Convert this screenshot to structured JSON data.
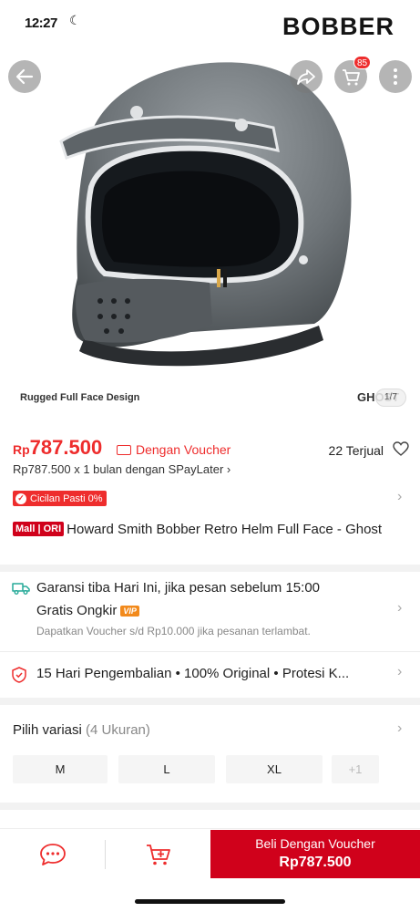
{
  "status_bar": {
    "time": "12:27",
    "moon_icon": "moon-icon"
  },
  "hero": {
    "brand_text": "BOBBER",
    "cart_count": "85",
    "caption": "Rugged Full Face Design",
    "model_text": "GHOST",
    "image_counter": "1/7",
    "icons": [
      "back-arrow-icon",
      "share-icon",
      "cart-icon",
      "more-icon"
    ]
  },
  "price": {
    "currency": "Rp",
    "amount": "787.500",
    "voucher_label": "Dengan Voucher",
    "sold": "22 Terjual",
    "spaylater": "Rp787.500 x 1 bulan dengan SPayLater",
    "cicilan": "Cicilan Pasti 0%"
  },
  "product": {
    "mall_badge": "Mall | ORI",
    "title": "Howard Smith Bobber Retro Helm Full Face - Ghost"
  },
  "shipping": {
    "line1": "Garansi tiba Hari Ini, jika pesan sebelum 15:00",
    "line2": "Gratis Ongkir",
    "vip": "VIP",
    "line3": "Dapatkan Voucher s/d Rp10.000 jika pesanan terlambat."
  },
  "guarantee": {
    "text": "15 Hari Pengembalian  •  100% Original  •  Protesi K..."
  },
  "variants": {
    "title": "Pilih variasi",
    "count": "(4 Ukuran)",
    "options": [
      "M",
      "L",
      "XL",
      "+1"
    ]
  },
  "bottom_bar": {
    "buy_line1": "Beli Dengan Voucher",
    "buy_line2": "Rp787.500"
  },
  "colors": {
    "accent": "#ee2d2d",
    "buy_button": "#d0011b",
    "helmet": "#6e7478"
  }
}
